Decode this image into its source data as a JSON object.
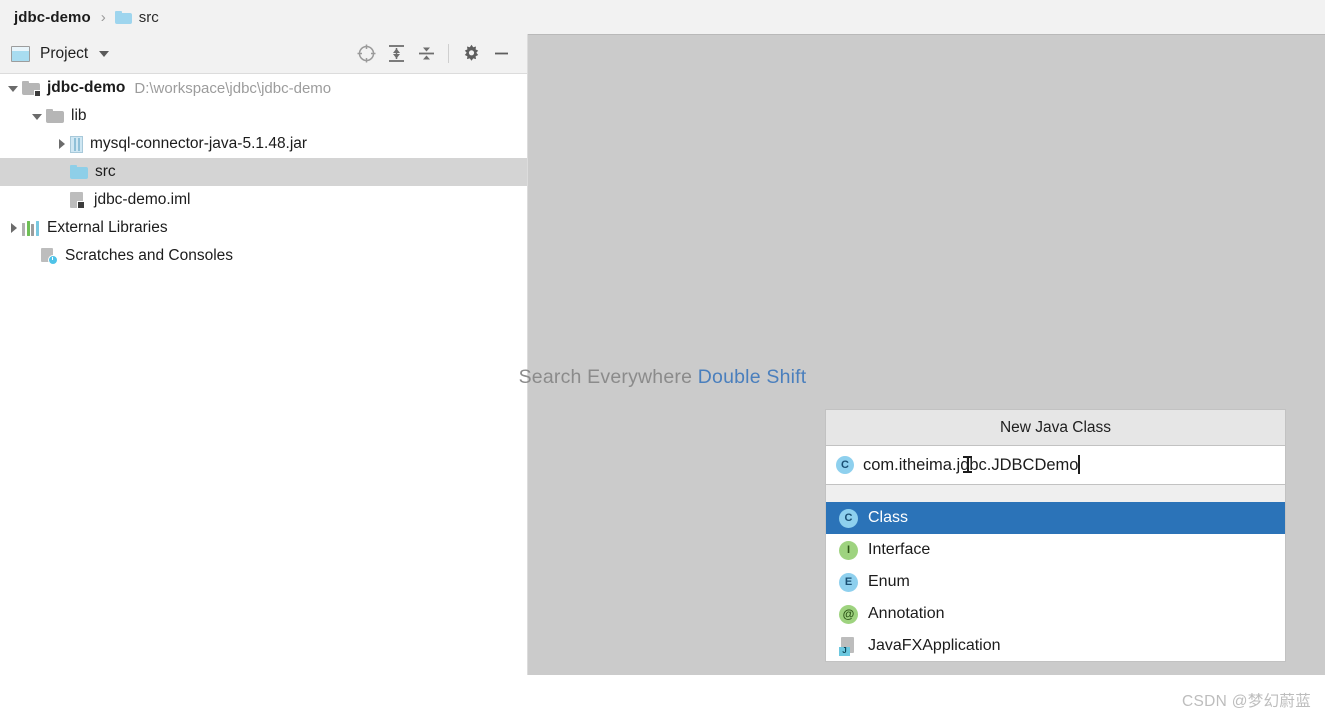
{
  "breadcrumb": {
    "project": "jdbc-demo",
    "separator": "›",
    "folder": "src"
  },
  "tool_window": {
    "title": "Project",
    "actions": [
      {
        "name": "locate-icon",
        "label": "Select Opened File"
      },
      {
        "name": "expand-all-icon",
        "label": "Expand All"
      },
      {
        "name": "collapse-all-icon",
        "label": "Collapse All"
      },
      {
        "name": "gear-icon",
        "label": "Settings"
      },
      {
        "name": "minimize-icon",
        "label": "Hide"
      }
    ]
  },
  "tree": {
    "rows": [
      {
        "label": "jdbc-demo",
        "path": "D:\\workspace\\jdbc\\jdbc-demo",
        "icon": "module-icon",
        "arrow": "down",
        "indent": 8,
        "bold": true,
        "selected": false
      },
      {
        "label": "lib",
        "path": "",
        "icon": "folder-gray-icon",
        "arrow": "down",
        "indent": 32,
        "bold": false,
        "selected": false
      },
      {
        "label": "mysql-connector-java-5.1.48.jar",
        "path": "",
        "icon": "jar-icon",
        "arrow": "right",
        "indent": 56,
        "bold": false,
        "selected": false
      },
      {
        "label": "src",
        "path": "",
        "icon": "folder-blue-icon",
        "arrow": "none",
        "indent": 56,
        "bold": false,
        "selected": true
      },
      {
        "label": "jdbc-demo.iml",
        "path": "",
        "icon": "iml-icon",
        "arrow": "none",
        "indent": 56,
        "bold": false,
        "selected": false
      },
      {
        "label": "External Libraries",
        "path": "",
        "icon": "libraries-icon",
        "arrow": "right",
        "indent": 8,
        "bold": false,
        "selected": false
      },
      {
        "label": "Scratches and Consoles",
        "path": "",
        "icon": "scratches-icon",
        "arrow": "none",
        "indent": 26,
        "bold": false,
        "selected": false
      }
    ]
  },
  "search_hint": {
    "label": "Search Everywhere",
    "shortcut": "Double Shift",
    "label_color": "#8b8b8b",
    "shortcut_color": "#4a7fbd"
  },
  "dialog": {
    "title": "New Java Class",
    "input_value": "com.itheima.jdbc.JDBCDemo",
    "input_icon": "C",
    "options": [
      {
        "label": "Class",
        "icon": "class-icon",
        "glyph": "C",
        "selected": true
      },
      {
        "label": "Interface",
        "icon": "interface-icon",
        "glyph": "I",
        "selected": false
      },
      {
        "label": "Enum",
        "icon": "enum-icon",
        "glyph": "E",
        "selected": false
      },
      {
        "label": "Annotation",
        "icon": "annotation-icon",
        "glyph": "@",
        "selected": false
      },
      {
        "label": "JavaFXApplication",
        "icon": "javafx-icon",
        "glyph": "J",
        "selected": false
      }
    ],
    "selection_color": "#2b73b8"
  },
  "watermark": "CSDN @梦幻蔚蓝"
}
